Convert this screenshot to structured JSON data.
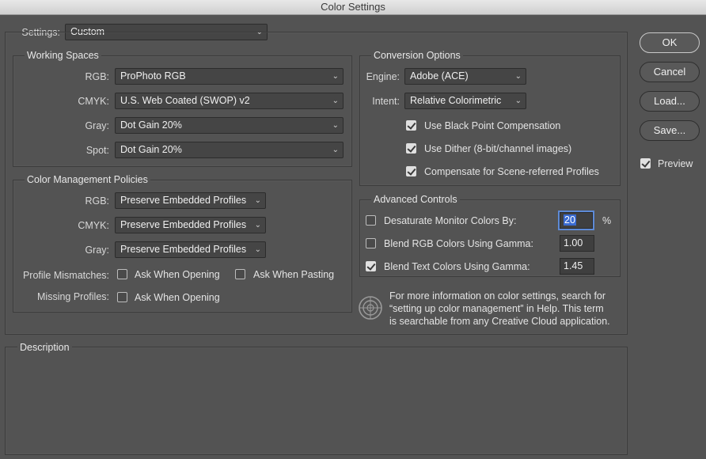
{
  "window": {
    "title": "Color Settings"
  },
  "settings": {
    "label": "Settings:",
    "value": "Custom"
  },
  "working_spaces": {
    "title": "Working Spaces",
    "rgb": {
      "label": "RGB:",
      "value": "ProPhoto RGB"
    },
    "cmyk": {
      "label": "CMYK:",
      "value": "U.S. Web Coated (SWOP) v2"
    },
    "gray": {
      "label": "Gray:",
      "value": "Dot Gain 20%"
    },
    "spot": {
      "label": "Spot:",
      "value": "Dot Gain 20%"
    }
  },
  "policies": {
    "title": "Color Management Policies",
    "rgb": {
      "label": "RGB:",
      "value": "Preserve Embedded Profiles"
    },
    "cmyk": {
      "label": "CMYK:",
      "value": "Preserve Embedded Profiles"
    },
    "gray": {
      "label": "Gray:",
      "value": "Preserve Embedded Profiles"
    },
    "mismatch_label": "Profile Mismatches:",
    "ask_opening": {
      "label": "Ask When Opening",
      "checked": false
    },
    "ask_pasting": {
      "label": "Ask When Pasting",
      "checked": false
    },
    "missing_label": "Missing Profiles:",
    "missing_ask_opening": {
      "label": "Ask When Opening",
      "checked": false
    }
  },
  "conversion": {
    "title": "Conversion Options",
    "engine": {
      "label": "Engine:",
      "value": "Adobe (ACE)"
    },
    "intent": {
      "label": "Intent:",
      "value": "Relative Colorimetric"
    },
    "black_point": {
      "label": "Use Black Point Compensation",
      "checked": true
    },
    "dither": {
      "label": "Use Dither (8-bit/channel images)",
      "checked": true
    },
    "scene_referred": {
      "label": "Compensate for Scene-referred Profiles",
      "checked": true
    }
  },
  "advanced": {
    "title": "Advanced Controls",
    "desaturate": {
      "label": "Desaturate Monitor Colors By:",
      "value": "20",
      "unit": "%",
      "checked": false
    },
    "blend_rgb": {
      "label": "Blend RGB Colors Using Gamma:",
      "value": "1.00",
      "checked": false
    },
    "blend_text": {
      "label": "Blend Text Colors Using Gamma:",
      "value": "1.45",
      "checked": true
    }
  },
  "info": {
    "line1": "For more information on color settings, search for",
    "line2": "“setting up color management” in Help. This term",
    "line3": "is searchable from any Creative Cloud application."
  },
  "description": {
    "title": "Description"
  },
  "buttons": {
    "ok": "OK",
    "cancel": "Cancel",
    "load": "Load...",
    "save": "Save..."
  },
  "preview": {
    "label": "Preview",
    "checked": true
  },
  "colors": {
    "background": "#535353",
    "focus": "#5d8ad6",
    "selection": "#3a6bd1"
  }
}
